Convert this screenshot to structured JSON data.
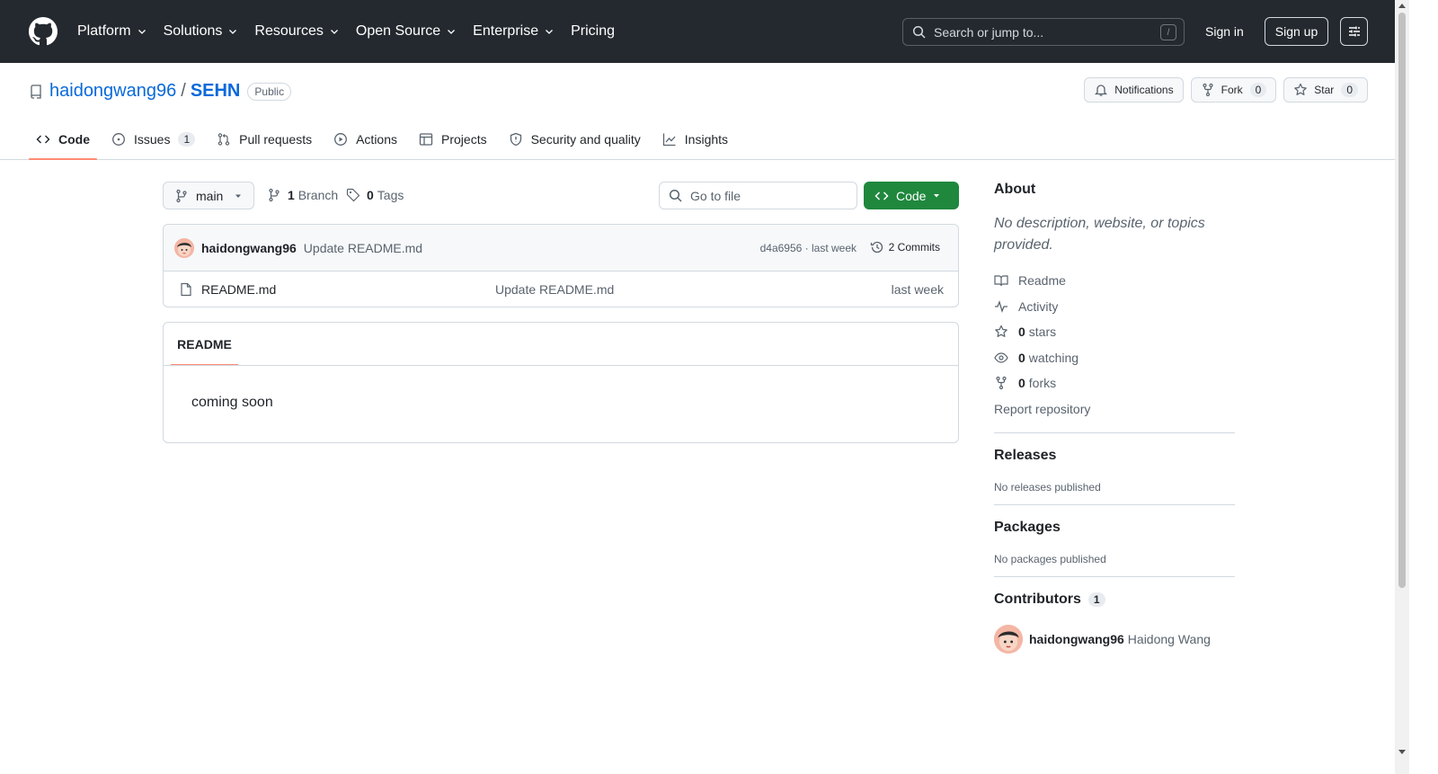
{
  "header": {
    "nav": [
      "Platform",
      "Solutions",
      "Resources",
      "Open Source",
      "Enterprise",
      "Pricing"
    ],
    "search_placeholder": "Search or jump to...",
    "search_shortcut": "/",
    "signin": "Sign in",
    "signup": "Sign up"
  },
  "repo": {
    "owner": "haidongwang96",
    "separator": "/",
    "name": "SEHN",
    "visibility": "Public",
    "notifications": "Notifications",
    "fork_label": "Fork",
    "fork_count": "0",
    "star_label": "Star",
    "star_count": "0"
  },
  "tabs": [
    {
      "label": "Code",
      "count": ""
    },
    {
      "label": "Issues",
      "count": "1"
    },
    {
      "label": "Pull requests",
      "count": ""
    },
    {
      "label": "Actions",
      "count": ""
    },
    {
      "label": "Projects",
      "count": ""
    },
    {
      "label": "Security and quality",
      "count": ""
    },
    {
      "label": "Insights",
      "count": ""
    }
  ],
  "toolbar": {
    "branch": "main",
    "branch_count": "1",
    "branch_label": "Branch",
    "tag_count": "0",
    "tag_label": "Tags",
    "go_to_file": "Go to file",
    "code_label": "Code"
  },
  "commit": {
    "author": "haidongwang96",
    "message": "Update README.md",
    "meta": "d4a6956 · last week",
    "commits": "2 Commits"
  },
  "files": [
    {
      "name": "README.md",
      "message": "Update README.md",
      "date": "last week"
    }
  ],
  "readme": {
    "tab": "README",
    "body": "coming soon"
  },
  "sidebar": {
    "about_title": "About",
    "description": "No description, website, or topics provided.",
    "readme": "Readme",
    "activity": "Activity",
    "stars_count": "0",
    "stars_label": "stars",
    "watching_count": "0",
    "watching_label": "watching",
    "forks_count": "0",
    "forks_label": "forks",
    "report": "Report repository",
    "releases_title": "Releases",
    "releases_text": "No releases published",
    "packages_title": "Packages",
    "packages_text": "No packages published",
    "contributors_title": "Contributors",
    "contributors_count": "1",
    "contributor_login": "haidongwang96",
    "contributor_name": "Haidong Wang"
  },
  "colors": {
    "header_bg": "#24292f",
    "link": "#0969da",
    "primary_button": "#1f883d",
    "active_tab_underline": "#fd8c73"
  }
}
